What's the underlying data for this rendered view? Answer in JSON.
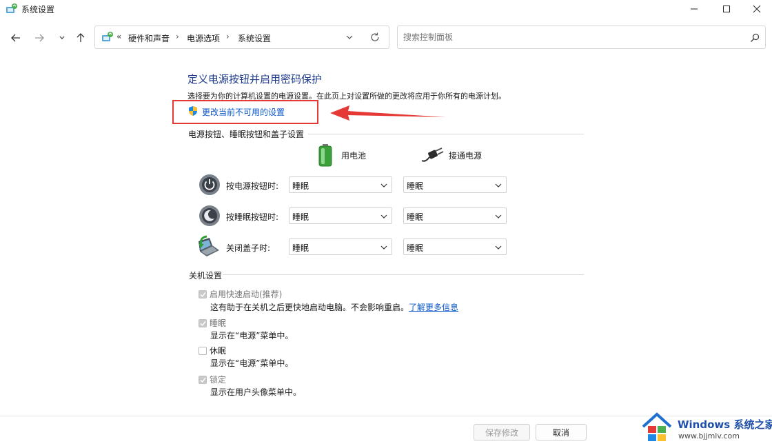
{
  "window": {
    "title": "系统设置"
  },
  "address_bar": {
    "overflow_symbol": "«",
    "breadcrumbs": [
      "硬件和声音",
      "电源选项",
      "系统设置"
    ],
    "separator": "›"
  },
  "search": {
    "placeholder": "搜索控制面板"
  },
  "content": {
    "heading": "定义电源按钮并启用密码保护",
    "description": "选择要为你的计算机设置的电源设置。在此页上对设置所做的更改将应用于你所有的电源计划。",
    "change_settings_link": "更改当前不可用的设置",
    "power_section": {
      "title": "电源按钮、睡眠按钮和盖子设置",
      "columns": [
        "用电池",
        "接通电源"
      ],
      "rows": [
        {
          "label": "按电源按钮时:",
          "battery": "睡眠",
          "plugged": "睡眠"
        },
        {
          "label": "按睡眠按钮时:",
          "battery": "睡眠",
          "plugged": "睡眠"
        },
        {
          "label": "关闭盖子时:",
          "battery": "睡眠",
          "plugged": "睡眠"
        }
      ]
    },
    "shutdown_section": {
      "title": "关机设置",
      "items": [
        {
          "label": "启用快速启动(推荐)",
          "checked": true,
          "enabled": false,
          "desc": "这有助于在关机之后更快地启动电脑。不会影响重启。",
          "link": "了解更多信息"
        },
        {
          "label": "睡眠",
          "checked": true,
          "enabled": false,
          "desc": "显示在“电源”菜单中。"
        },
        {
          "label": "休眠",
          "checked": false,
          "enabled": true,
          "desc": "显示在“电源”菜单中。"
        },
        {
          "label": "锁定",
          "checked": true,
          "enabled": false,
          "desc": "显示在用户头像菜单中。"
        }
      ]
    }
  },
  "footer": {
    "save_label": "保存修改",
    "cancel_label": "取消"
  },
  "watermark": {
    "brand": "Windows",
    "brand_suffix": "系统之家",
    "url": "www.bjjmlv.com"
  },
  "colors": {
    "heading": "#1e3a8a",
    "link": "#0a58ca",
    "highlight": "#e53935"
  }
}
